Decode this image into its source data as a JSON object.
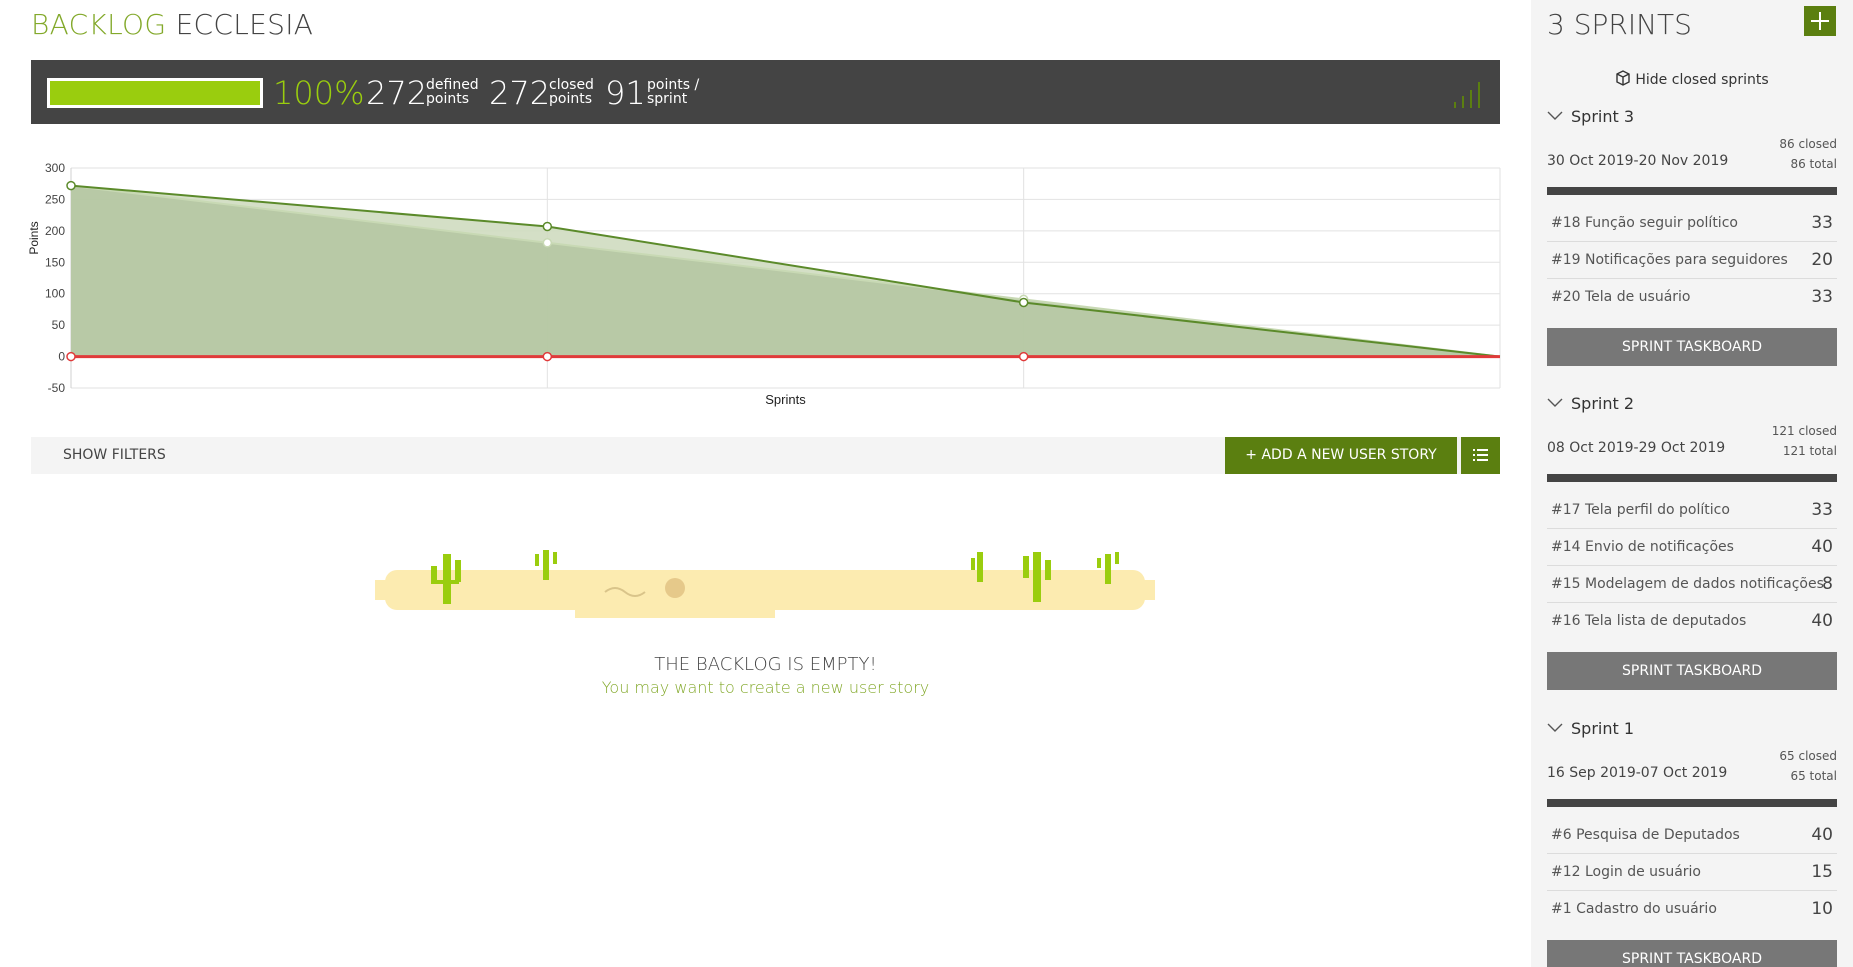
{
  "header": {
    "title_part1": "BACKLOG",
    "title_part2": "ECCLESIA"
  },
  "summary": {
    "progress_percent": 100,
    "percent_label": "100%",
    "defined_points": "272",
    "defined_label_1": "defined",
    "defined_label_2": "points",
    "closed_points": "272",
    "closed_label_1": "closed",
    "closed_label_2": "points",
    "velocity": "91",
    "velocity_label_1": "points /",
    "velocity_label_2": "sprint"
  },
  "chart_data": {
    "type": "area",
    "xlabel": "Sprints",
    "ylabel": "Points",
    "ylim": [
      -50,
      300
    ],
    "yticks": [
      300,
      250,
      200,
      150,
      100,
      50,
      0,
      -50
    ],
    "grid": true,
    "x": [
      0,
      1,
      2,
      3
    ],
    "series": [
      {
        "values": [
          272,
          207,
          86,
          0
        ],
        "color": "#5b8a2a"
      },
      {
        "values": [
          272,
          181,
          91,
          0
        ],
        "color": "#c8d9b4"
      },
      {
        "values": [
          0,
          0,
          0,
          0
        ],
        "color": "#e03a3a"
      }
    ]
  },
  "filters": {
    "show_filters": "SHOW FILTERS",
    "add_story": "+ ADD A NEW USER STORY"
  },
  "empty": {
    "title": "THE BACKLOG IS EMPTY!",
    "subtitle": "You may want to create a new user story"
  },
  "sidebar": {
    "title": "3 SPRINTS",
    "hide_closed": "Hide closed sprints",
    "taskboard_label": "SPRINT TASKBOARD",
    "sprints": [
      {
        "name": "Sprint 3",
        "closed": "86 closed",
        "total": "86 total",
        "dates": "30 Oct 2019-20 Nov 2019",
        "stories": [
          {
            "label": "#18 Função seguir político",
            "points": "33"
          },
          {
            "label": "#19 Notificações para seguidores",
            "points": "20"
          },
          {
            "label": "#20 Tela de usuário",
            "points": "33"
          }
        ]
      },
      {
        "name": "Sprint 2",
        "closed": "121 closed",
        "total": "121 total",
        "dates": "08 Oct 2019-29 Oct 2019",
        "stories": [
          {
            "label": "#17 Tela perfil do político",
            "points": "33"
          },
          {
            "label": "#14 Envio de notificações",
            "points": "40"
          },
          {
            "label": "#15 Modelagem de dados notificações",
            "points": "8"
          },
          {
            "label": "#16 Tela lista de deputados",
            "points": "40"
          }
        ]
      },
      {
        "name": "Sprint 1",
        "closed": "65 closed",
        "total": "65 total",
        "dates": "16 Sep 2019-07 Oct 2019",
        "stories": [
          {
            "label": "#6 Pesquisa de Deputados",
            "points": "40"
          },
          {
            "label": "#12 Login de usuário",
            "points": "15"
          },
          {
            "label": "#1 Cadastro do usuário",
            "points": "10"
          }
        ]
      }
    ]
  }
}
